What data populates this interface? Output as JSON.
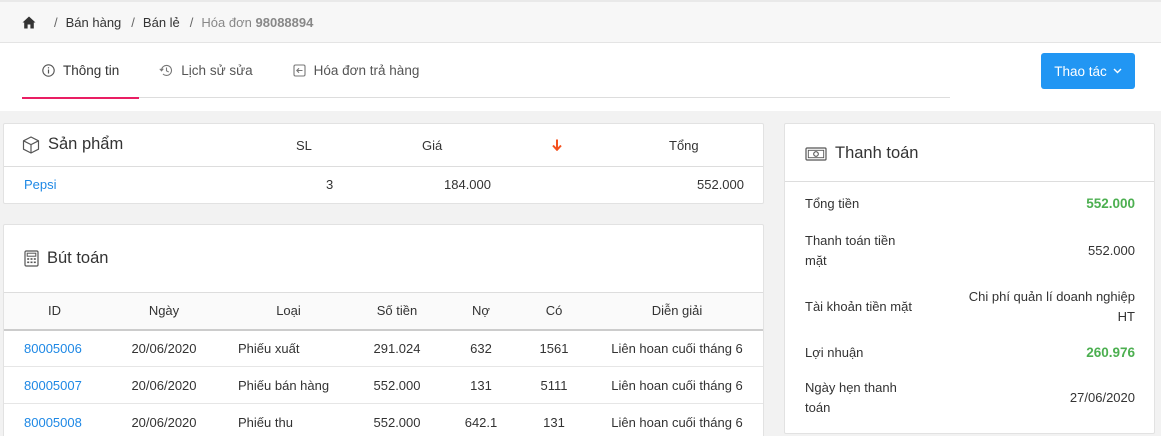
{
  "breadcrumb": {
    "items": [
      "Bán hàng",
      "Bán lẻ"
    ],
    "current_prefix": "Hóa đơn",
    "current_id": "98088894"
  },
  "tabs": [
    {
      "label": "Thông tin",
      "icon": "info-icon",
      "active": true
    },
    {
      "label": "Lịch sử sửa",
      "icon": "history-icon",
      "active": false
    },
    {
      "label": "Hóa đơn trả hàng",
      "icon": "return-icon",
      "active": false
    }
  ],
  "action_button": {
    "label": "Thao tác"
  },
  "products": {
    "title": "Sản phẩm",
    "columns": {
      "qty": "SL",
      "price": "Giá",
      "total": "Tổng"
    },
    "rows": [
      {
        "name": "Pepsi",
        "qty": "3",
        "price": "184.000",
        "total": "552.000"
      }
    ]
  },
  "entries": {
    "title": "Bút toán",
    "columns": [
      "ID",
      "Ngày",
      "Loại",
      "Số tiền",
      "Nợ",
      "Có",
      "Diễn giải"
    ],
    "rows": [
      {
        "id": "80005006",
        "date": "20/06/2020",
        "type": "Phiếu xuất",
        "amount": "291.024",
        "debit": "632",
        "credit": "1561",
        "desc": "Liên hoan cuối tháng 6"
      },
      {
        "id": "80005007",
        "date": "20/06/2020",
        "type": "Phiếu bán hàng",
        "amount": "552.000",
        "debit": "131",
        "credit": "5111",
        "desc": "Liên hoan cuối tháng 6"
      },
      {
        "id": "80005008",
        "date": "20/06/2020",
        "type": "Phiếu thu",
        "amount": "552.000",
        "debit": "642.1",
        "credit": "131",
        "desc": "Liên hoan cuối tháng 6"
      }
    ]
  },
  "payment": {
    "title": "Thanh toán",
    "total_label": "Tổng tiền",
    "total_value": "552.000",
    "cash_label": "Thanh toán tiền mặt",
    "cash_value": "552.000",
    "account_label": "Tài khoản tiền mặt",
    "account_value": "Chi phí quản lí doanh nghiệp HT",
    "profit_label": "Lợi nhuận",
    "profit_value": "260.976",
    "due_label": "Ngày hẹn thanh toán",
    "due_value": "27/06/2020"
  },
  "colors": {
    "accent": "#2196f3",
    "tab_active": "#e91e63",
    "link": "#1e88e5",
    "positive": "#4caf50",
    "sort_arrow": "#f4511e"
  }
}
